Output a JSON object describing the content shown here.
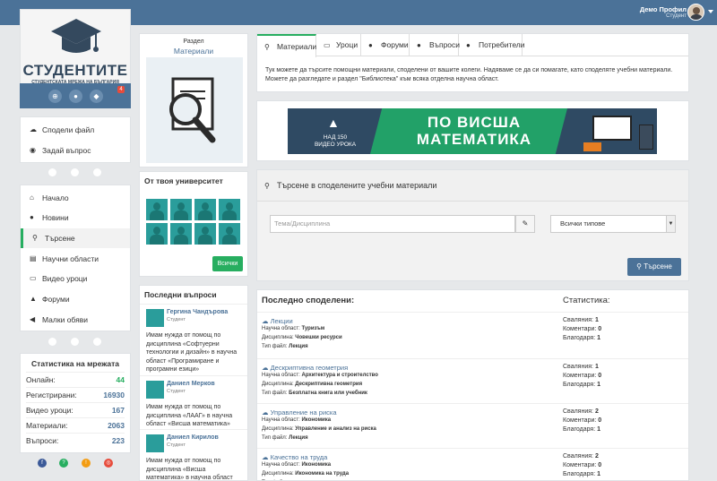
{
  "header": {
    "profile_name": "Демо Профил",
    "profile_role": "Студент"
  },
  "logo": {
    "word": "СТУДЕНТИТЕ",
    "sub": "СТУДЕНТСКАТА МРЕЖА НА БЪЛГАРИЯ",
    "badge": "4"
  },
  "actions": [
    {
      "icon": "cloud-upload-icon",
      "label": "Сподели файл"
    },
    {
      "icon": "chat-icon",
      "label": "Задай въпрос"
    }
  ],
  "nav": [
    {
      "icon": "home-icon",
      "label": "Начало"
    },
    {
      "icon": "info-icon",
      "label": "Новини"
    },
    {
      "icon": "search-icon",
      "label": "Търсене"
    },
    {
      "icon": "book-icon",
      "label": "Научни области"
    },
    {
      "icon": "monitor-icon",
      "label": "Видео уроци"
    },
    {
      "icon": "graduation-icon",
      "label": "Форуми"
    },
    {
      "icon": "megaphone-icon",
      "label": "Малки обяви"
    }
  ],
  "stats": {
    "title": "Статистика на мрежата",
    "rows": [
      {
        "label": "Онлайн:",
        "value": "44",
        "color": "#27ae60"
      },
      {
        "label": "Регистрирани:",
        "value": "16930",
        "color": "#4b7298"
      },
      {
        "label": "Видео уроци:",
        "value": "167",
        "color": "#4b7298"
      },
      {
        "label": "Материали:",
        "value": "2063",
        "color": "#4b7298"
      },
      {
        "label": "Въпроси:",
        "value": "223",
        "color": "#4b7298"
      }
    ]
  },
  "section": {
    "label": "Раздел",
    "title": "Материали"
  },
  "univ": {
    "title": "От твоя университет",
    "btn": "Всички"
  },
  "lastq": {
    "title": "Последни въпроси",
    "items": [
      {
        "name": "Гергина Чандърова",
        "role": "Студент",
        "text": "Имам нужда от помощ по дисциплина «Софтуерни технологии и дизайн» в научна област «Програмиране и програмни езици»"
      },
      {
        "name": "Даниел Мерков",
        "role": "Студент",
        "text": "Имам нужда от помощ по дисциплина «ЛААГ» в научна област «Висша математика»"
      },
      {
        "name": "Даниел Кирилов",
        "role": "Студент",
        "text": "Имам нужда от помощ по дисциплина «Висша математика» в научна област"
      }
    ]
  },
  "tabs": [
    {
      "icon": "search-icon",
      "label": "Материали"
    },
    {
      "icon": "monitor-icon",
      "label": "Уроци"
    },
    {
      "icon": "info-icon",
      "label": "Форуми"
    },
    {
      "icon": "question-icon",
      "label": "Въпроси"
    },
    {
      "icon": "user-icon",
      "label": "Потребители"
    }
  ],
  "tab_text": "Тук можете да търсите помощни материали, споделени от вашите колеги. Надяваме се да си помагате, като споделяте учебни материали. Можете да разгледате и раздел \"Библиотека\" към всяка отделна научна област.",
  "banner": {
    "line1": "ПО ВИСША",
    "line2": "МАТЕМАТИКА",
    "small": "НАД 150 ВИДЕО УРОКА"
  },
  "search": {
    "title": "Търсене в споделените учебни материали",
    "placeholder": "Тема/Дисциплина",
    "select": "Всички типове",
    "button": "Търсене"
  },
  "shared": {
    "title": "Последно споделени:",
    "stats_title": "Статистика:",
    "items": [
      {
        "title": "Лекции",
        "area": "Туризъм",
        "disc": "Човешки ресурси",
        "type": "Лекция",
        "downloads": "1",
        "comments": "0",
        "thanks": "1"
      },
      {
        "title": "Дескриптивна геометрия",
        "area": "Архитектура и строителство",
        "disc": "Дескриптивна геометрия",
        "type": "Безплатна книга или учебник",
        "downloads": "1",
        "comments": "0",
        "thanks": "1"
      },
      {
        "title": "Управление на риска",
        "area": "Икономика",
        "disc": "Управление и анализ на риска",
        "type": "Лекция",
        "downloads": "2",
        "comments": "0",
        "thanks": "1"
      },
      {
        "title": "Качество на труда",
        "area": "Икономика",
        "disc": "Икономика на труда",
        "type": "Лекция",
        "downloads": "2",
        "comments": "0",
        "thanks": "1"
      }
    ],
    "labels": {
      "area": "Научна област:",
      "disc": "Дисциплина:",
      "type": "Тип файл:",
      "downloads": "Сваляния:",
      "comments": "Коментари:",
      "thanks": "Благодаря:"
    }
  }
}
